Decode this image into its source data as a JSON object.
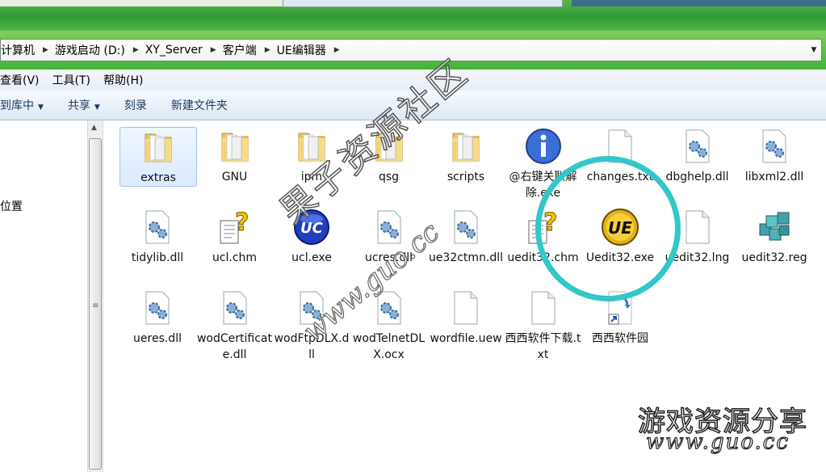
{
  "address": {
    "crumbs": [
      "计算机",
      "游戏启动 (D:)",
      "XY_Server",
      "客户端",
      "UE编辑器"
    ]
  },
  "menu": {
    "items": [
      "查看(V)",
      "工具(T)",
      "帮助(H)"
    ]
  },
  "toolbar": {
    "include_library": "到库中",
    "share": "共享",
    "burn": "刻录",
    "new_folder": "新建文件夹"
  },
  "nav": {
    "location_label": "位置"
  },
  "files": [
    {
      "name": "extras",
      "icon": "folder-icon"
    },
    {
      "name": "GNU",
      "icon": "folder-icon"
    },
    {
      "name": "ipm",
      "icon": "folder-icon"
    },
    {
      "name": "qsg",
      "icon": "folder-icon"
    },
    {
      "name": "scripts",
      "icon": "folder-icon"
    },
    {
      "name": "@右键关联解除.exe",
      "icon": "info-exe-icon"
    },
    {
      "name": "changes.txt",
      "icon": "text-file-icon"
    },
    {
      "name": "dbghelp.dll",
      "icon": "dll-gear-icon"
    },
    {
      "name": "libxml2.dll",
      "icon": "dll-gear-icon"
    },
    {
      "name": "tidylib.dll",
      "icon": "dll-gear-icon"
    },
    {
      "name": "ucl.chm",
      "icon": "help-chm-icon"
    },
    {
      "name": "ucl.exe",
      "icon": "uc-exe-icon"
    },
    {
      "name": "ucres.dll",
      "icon": "dll-gear-icon"
    },
    {
      "name": "ue32ctmn.dll",
      "icon": "dll-gear-icon"
    },
    {
      "name": "uedit32.chm",
      "icon": "help-chm-icon"
    },
    {
      "name": "Uedit32.exe",
      "icon": "ue-exe-icon"
    },
    {
      "name": "uedit32.lng",
      "icon": "blank-file-icon"
    },
    {
      "name": "uedit32.reg",
      "icon": "registry-icon"
    },
    {
      "name": "ueres.dll",
      "icon": "dll-gear-icon"
    },
    {
      "name": "wodCertificate.dll",
      "icon": "dll-gear-icon"
    },
    {
      "name": "wodFtpDLX.dll",
      "icon": "dll-gear-icon"
    },
    {
      "name": "wodTelnetDLX.ocx",
      "icon": "dll-gear-icon"
    },
    {
      "name": "wordfile.uew",
      "icon": "blank-file-icon"
    },
    {
      "name": "西西软件下载.txt",
      "icon": "text-file-icon"
    },
    {
      "name": "西西软件园",
      "icon": "shortcut-icon"
    }
  ],
  "watermark": {
    "diagonal": "果子资源社区",
    "diagonal_url": "www.guo.cc",
    "corner_title": "游戏资源分享",
    "corner_url": "www.guo.cc"
  },
  "colors": {
    "highlight_circle": "#32c7c8",
    "title_green": "#44b43a",
    "toolbar_blue": "#dde8f4"
  }
}
